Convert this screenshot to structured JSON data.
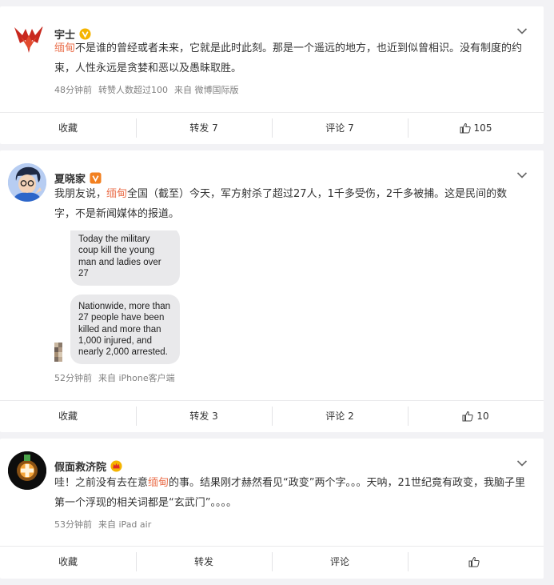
{
  "posts": [
    {
      "author": "宇士",
      "badge_type": "gold-v",
      "avatar_icon": "red-flame-logo-icon",
      "text_pre": "",
      "keyword": "缅甸",
      "text_post": "不是谁的曾经或者未来，它就是此时此刻。那是一个遥远的地方，也近到似曾相识。没有制度的约束，人性永远是贪婪和恶以及愚昧取胜。",
      "time": "48分钟前",
      "extra": "转赞人数超过100",
      "source": "来自 微博国际版",
      "actions": {
        "collect": "收藏",
        "repost": "转发 7",
        "comment": "评论 7",
        "like": "105"
      }
    },
    {
      "author": "夏晓家",
      "badge_type": "orange-v",
      "avatar_icon": "cartoon-avatar-icon",
      "text_pre": "我朋友说，",
      "keyword": "缅甸",
      "text_post": "全国（截至）今天，军方射杀了超过27人，1千多受伤，2千多被捕。这是民间的数字，不是新闻媒体的报道。",
      "embedded_messages": [
        "Today the military coup kill the young man and ladies over 27",
        "Nationwide, more than 27 people have been killed and more than 1,000 injured, and nearly 2,000 arrested."
      ],
      "time": "52分钟前",
      "source": "来自 iPhone客户端",
      "actions": {
        "collect": "收藏",
        "repost": "转发 3",
        "comment": "评论 2",
        "like": "10"
      }
    },
    {
      "author": "假面救济院",
      "badge_type": "crown",
      "avatar_icon": "glowing-cross-avatar-icon",
      "text_pre": "哇！之前没有去在意",
      "keyword": "缅甸",
      "text_post": "的事。结果刚才赫然看见“政变”两个字。。。天呐，21世纪竟有政变，我脑子里第一个浮现的相关词都是“玄武门”。。。。",
      "time": "53分钟前",
      "source": "来自 iPad air",
      "actions": {
        "collect": "收藏",
        "repost": "转发",
        "comment": "评论",
        "like": ""
      }
    }
  ],
  "colors": {
    "keyword": "#eb7350",
    "background": "#f2f2f5",
    "meta": "#808080"
  }
}
